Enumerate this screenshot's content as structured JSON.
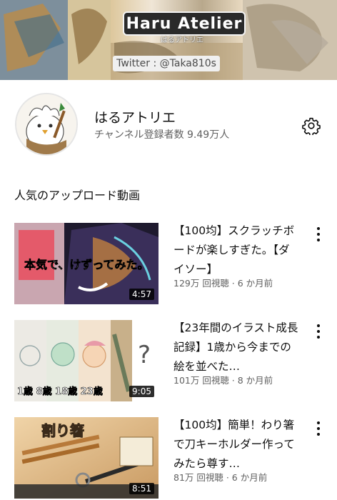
{
  "banner": {
    "title": "Haru Atelier",
    "subtitle": "はるアトリエ",
    "twitter": "Twitter : @Taka810s"
  },
  "channel": {
    "name": "はるアトリエ",
    "subscribers": "チャンネル登録者数 9.49万人",
    "settings_icon": "gear-icon"
  },
  "section": {
    "title": "人気のアップロード動画"
  },
  "videos": [
    {
      "title": "【100均】スクラッチボードが楽しすぎた。【ダイソー】",
      "meta": "129万 回視聴 · 6 か月前",
      "duration": "4:57",
      "thumb_text": "本気で、けずってみた。"
    },
    {
      "title": "【23年間のイラスト成長記録】1歳から今までの絵を並べた…",
      "meta": "101万 回視聴 · 8 か月前",
      "duration": "9:05",
      "thumb_text": "1歳 8歳 18歳 23歳"
    },
    {
      "title": "【100均】簡単！わり箸で刀キーホルダー作ってみたら尊す…",
      "meta": "81万 回視聴 · 6 か月前",
      "duration": "8:51",
      "thumb_text": "割り箸"
    }
  ]
}
